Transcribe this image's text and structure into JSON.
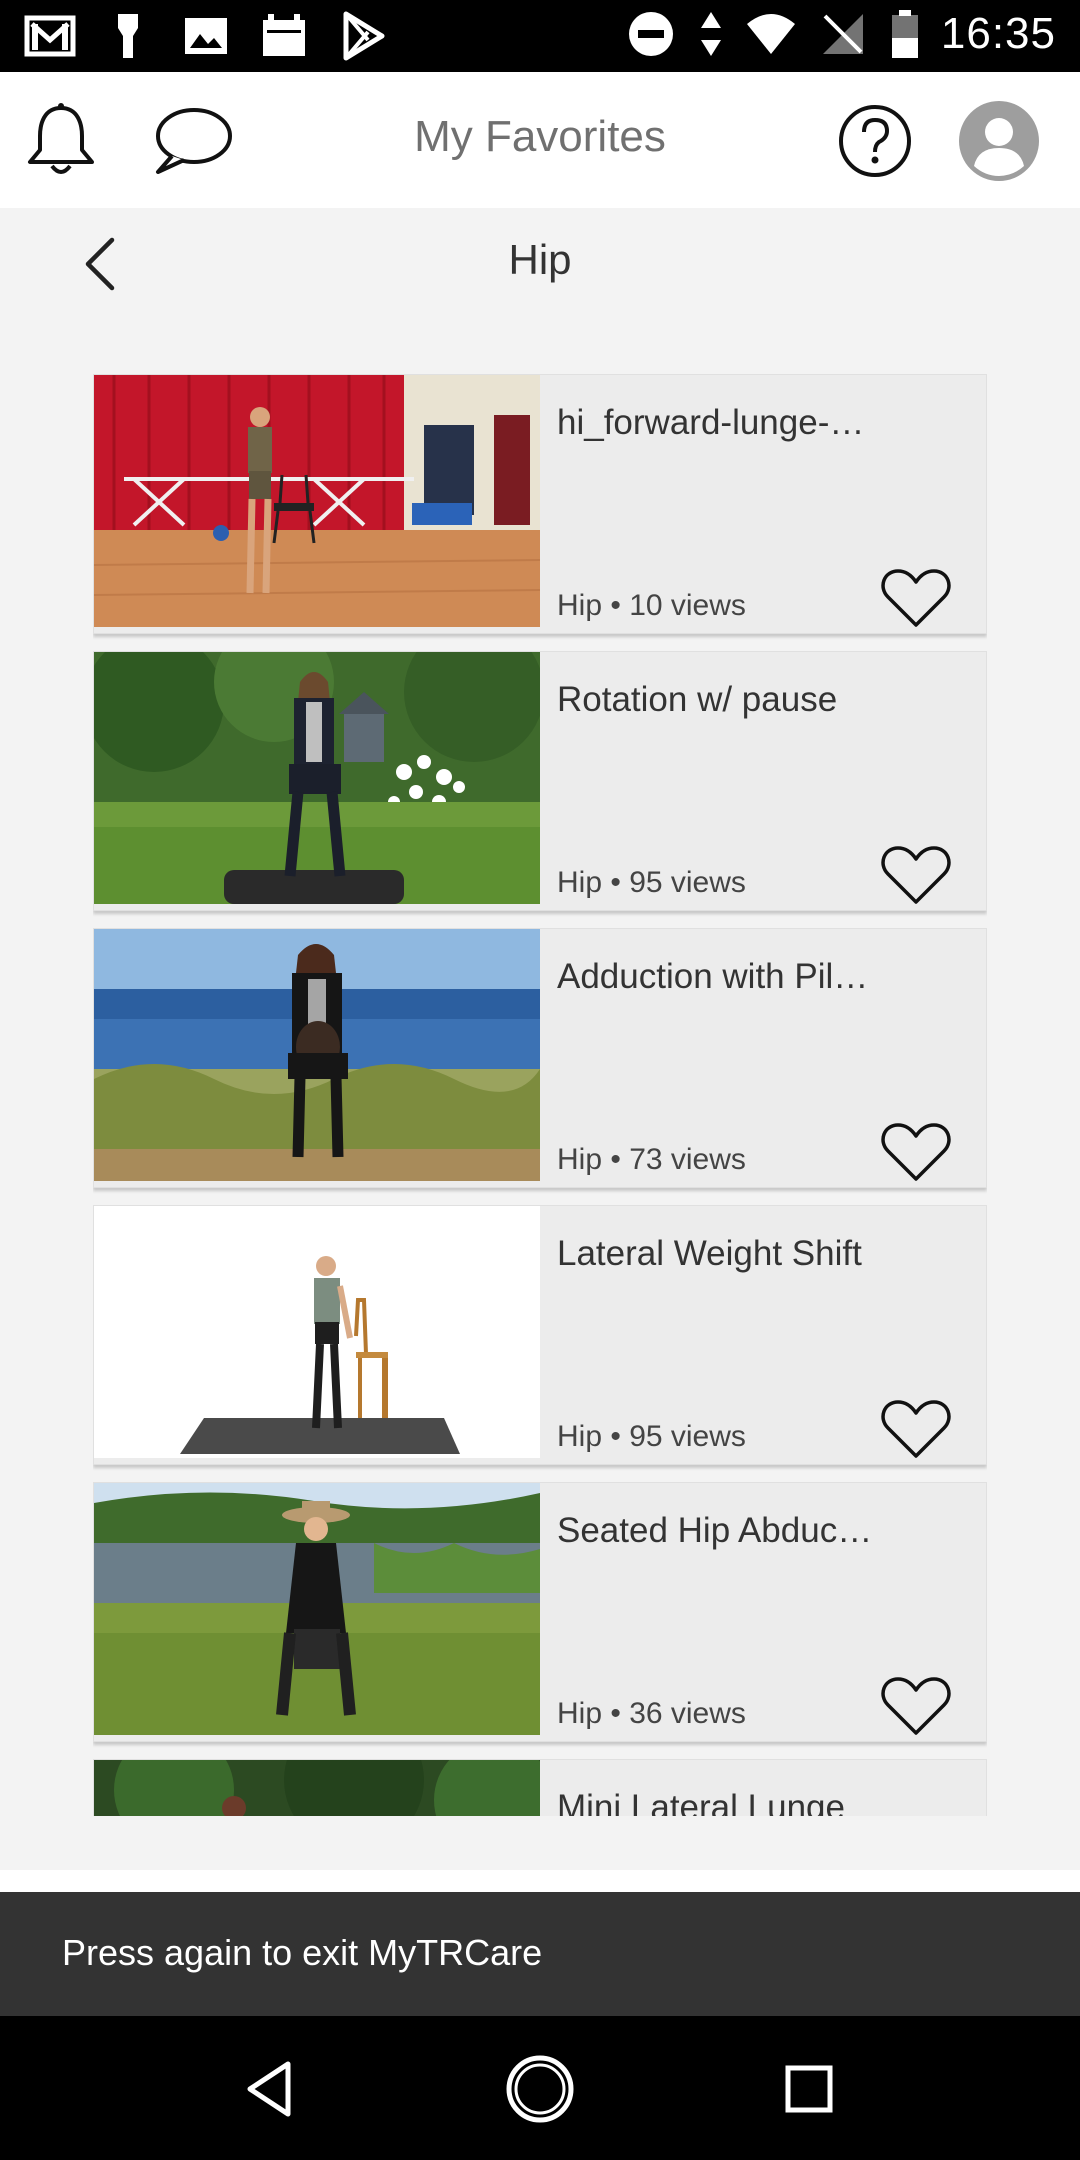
{
  "status_bar": {
    "time": "16:35",
    "left_icons": [
      "gmail-icon",
      "flashlight-icon",
      "image-icon",
      "calendar-icon",
      "play-store-icon"
    ],
    "right_icons": [
      "do-not-disturb-icon",
      "data-arrows-icon",
      "wifi-icon",
      "no-signal-icon",
      "battery-icon"
    ]
  },
  "header": {
    "title": "My Favorites"
  },
  "subheader": {
    "title": "Hip"
  },
  "videos": [
    {
      "title": "hi_forward-lunge-…",
      "meta": "Hip • 10 views",
      "thumb_scene": "studio-red-curtain"
    },
    {
      "title": "Rotation w/ pause",
      "meta": "Hip • 95 views",
      "thumb_scene": "garden"
    },
    {
      "title": "Adduction with Pil…",
      "meta": "Hip • 73 views",
      "thumb_scene": "ocean"
    },
    {
      "title": "Lateral Weight Shift",
      "meta": "Hip • 95 views",
      "thumb_scene": "white-studio"
    },
    {
      "title": "Seated Hip Abduc…",
      "meta": "Hip • 36 views",
      "thumb_scene": "lake"
    },
    {
      "title": "Mini Lateral Lunge",
      "meta": "",
      "thumb_scene": "forest"
    }
  ],
  "toast": {
    "message": "Press again to exit MyTRCare"
  },
  "colors": {
    "header_bg": "#ffffff",
    "page_bg": "#f3f3f3",
    "card_bg": "#ececec",
    "toast_bg": "#333333"
  }
}
